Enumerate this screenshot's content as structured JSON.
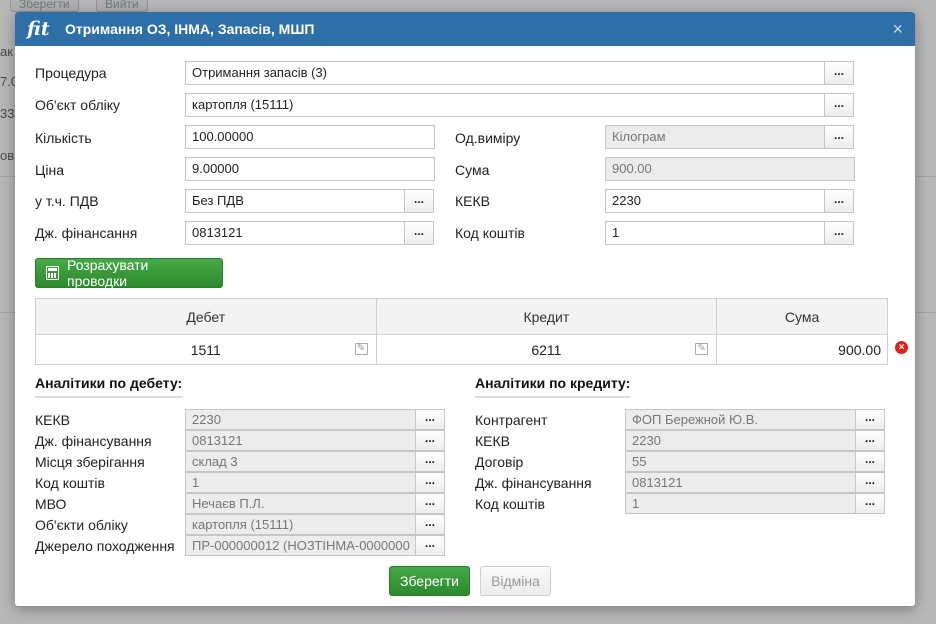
{
  "background": {
    "btn1": "Зберегти",
    "btn2": "Вийти",
    "frag1": "ак",
    "frag2": "7.0",
    "frag3": "33",
    "frag4": "ов"
  },
  "dialog": {
    "logo": "fit",
    "title": "Отримання ОЗ, ІНМА, Запасів, МШП",
    "close": "×"
  },
  "form": {
    "procedure_label": "Процедура",
    "procedure_value": "Отримання запасів (3)",
    "object_label": "Об'єкт обліку",
    "object_value": "картопля (15111)",
    "quantity_label": "Кількість",
    "quantity_value": "100.00000",
    "unit_label": "Од.виміру",
    "unit_value": "Кілограм",
    "price_label": "Ціна",
    "price_value": "9.00000",
    "sum_label": "Сума",
    "sum_value": "900.00",
    "vat_label": "у т.ч. ПДВ",
    "vat_value": "Без ПДВ",
    "kekv_label": "КЕКВ",
    "kekv_value": "2230",
    "fin_label": "Дж. фінансання",
    "fin_value": "0813121",
    "fund_label": "Код коштів",
    "fund_value": "1",
    "dots": "..."
  },
  "calc_button": "Розрахувати проводки",
  "entries": {
    "headers": [
      "Дебет",
      "Кредит",
      "Сума"
    ],
    "rows": [
      {
        "debit": "1511",
        "credit": "6211",
        "sum": "900.00"
      }
    ]
  },
  "debit_analytics": {
    "title": "Аналітики по дебету:",
    "items": [
      {
        "label": "КЕКВ",
        "value": "2230"
      },
      {
        "label": "Дж. фінансування",
        "value": "0813121"
      },
      {
        "label": "Місця зберігання",
        "value": "склад 3"
      },
      {
        "label": "Код коштів",
        "value": "1"
      },
      {
        "label": "МВО",
        "value": "Нечаєв П.Л."
      },
      {
        "label": "Об'єкти обліку",
        "value": "картопля (15111)"
      },
      {
        "label": "Джерело походження",
        "value": "ПР-000000012 (НОЗТІНМА-0000000"
      }
    ]
  },
  "credit_analytics": {
    "title": "Аналітики по кредиту:",
    "items": [
      {
        "label": "Контрагент",
        "value": "ФОП Бережной Ю.В."
      },
      {
        "label": "КЕКВ",
        "value": "2230"
      },
      {
        "label": "Договір",
        "value": "55"
      },
      {
        "label": "Дж. фінансування",
        "value": "0813121"
      },
      {
        "label": "Код коштів",
        "value": "1"
      }
    ]
  },
  "footer": {
    "save": "Зберегти",
    "cancel": "Відміна"
  },
  "colors": {
    "header": "#2f6fa8",
    "primary_button": "#3a9a3a"
  }
}
